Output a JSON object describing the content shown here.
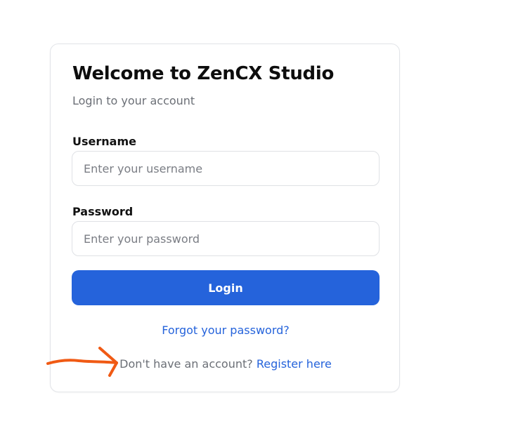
{
  "login": {
    "title": "Welcome to ZenCX Studio",
    "subtitle": "Login to your account",
    "username_label": "Username",
    "username_placeholder": "Enter your username",
    "password_label": "Password",
    "password_placeholder": "Enter your password",
    "login_button": "Login",
    "forgot_link": "Forgot your password?",
    "no_account_text": "Don't have an account?",
    "register_link": "Register here"
  },
  "annotation": {
    "arrow_icon": "arrow-right-icon",
    "arrow_color": "#f05a14"
  },
  "colors": {
    "accent": "#2563db",
    "muted_text": "#6b6f76",
    "border": "#e2e4e8"
  }
}
